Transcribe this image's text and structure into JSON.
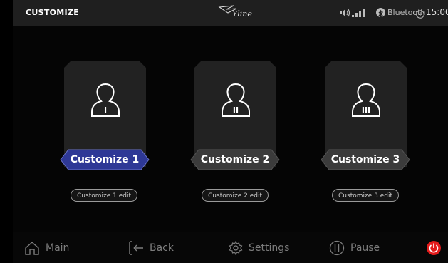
{
  "header": {
    "title": "CUSTOMIZE",
    "logo_text": "Yline",
    "bluetooth_label": "Bluetooth",
    "time": "15:00"
  },
  "cards": [
    {
      "label": "Customize 1",
      "numeral": "I",
      "edit_label": "Customize 1 edit",
      "selected": true
    },
    {
      "label": "Customize 2",
      "numeral": "II",
      "edit_label": "Customize 2 edit",
      "selected": false
    },
    {
      "label": "Customize 3",
      "numeral": "III",
      "edit_label": "Customize 3 edit",
      "selected": false
    }
  ],
  "footer": {
    "main_label": "Main",
    "back_label": "Back",
    "settings_label": "Settings",
    "pause_label": "Pause"
  },
  "colors": {
    "selected_pill": "#2e3896",
    "unselected_pill": "#3b3b3b",
    "card_bg": "#222222",
    "power_red": "#e21b1b"
  }
}
